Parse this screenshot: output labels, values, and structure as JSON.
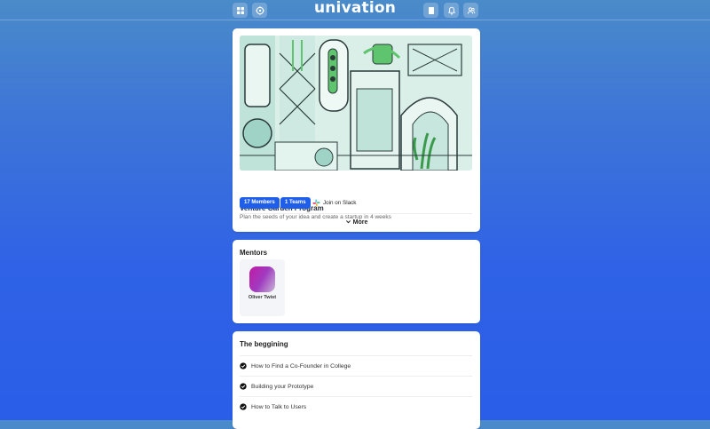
{
  "app": {
    "logo_text": "univation"
  },
  "topbar": {
    "left_icons": [
      "grid-icon",
      "compass-icon"
    ],
    "right_icons": [
      "book-icon",
      "bell-icon",
      "users-icon"
    ]
  },
  "program": {
    "title": "Venture Garden Program",
    "subtitle": "Plan the seeds of your idea and create a startup in 4 weeks",
    "members_badge": "17 Members",
    "teams_badge": "1 Teams",
    "slack_label": "Join on Slack",
    "more_label": "More"
  },
  "mentors": {
    "title": "Mentors",
    "items": [
      {
        "name": "Oliver Twist"
      }
    ]
  },
  "beginning": {
    "title": "The beggining",
    "lessons": [
      {
        "label": "How to Find a Co-Founder in College"
      },
      {
        "label": "Building your Prototype"
      },
      {
        "label": "How to Talk to Users"
      }
    ]
  },
  "colors": {
    "accent": "#1f5ee8",
    "background_top": "#4a8bc9",
    "background_bottom": "#2a5ee8"
  }
}
